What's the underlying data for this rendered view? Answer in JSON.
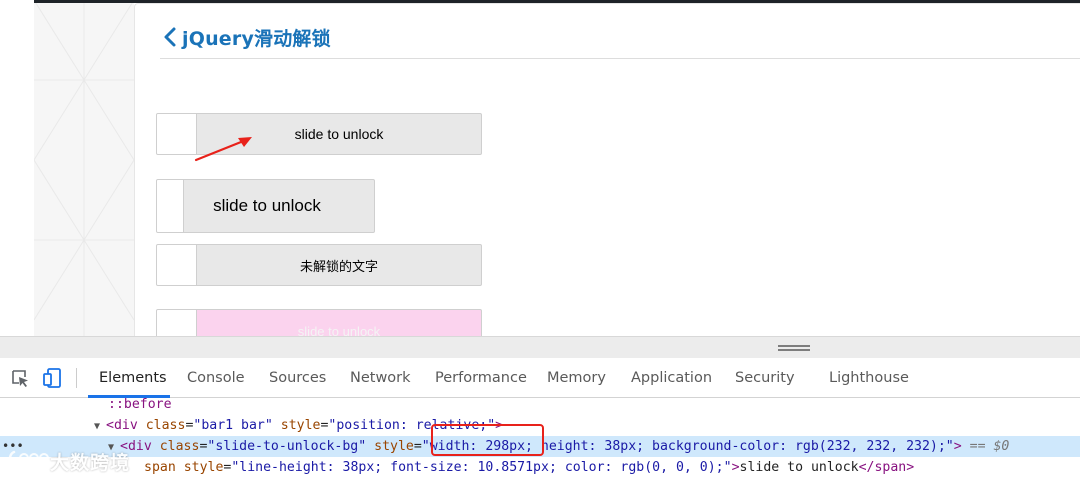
{
  "page": {
    "title": "jQuery滑动解锁",
    "back_icon": "chevron-left-icon",
    "sliders": [
      {
        "label": "slide to unlock"
      },
      {
        "label": "slide to unlock"
      },
      {
        "label": "未解锁的文字"
      },
      {
        "label": "slide to unlock"
      }
    ],
    "accent_color": "#1a73b8",
    "pink_color": "#fbd3ee",
    "annotation_color": "#e8221b"
  },
  "devtools": {
    "tabs": [
      "Elements",
      "Console",
      "Sources",
      "Network",
      "Performance",
      "Memory",
      "Application",
      "Security",
      "Lighthouse"
    ],
    "active_tab": "Elements",
    "tree": {
      "line1": "::before",
      "line2_tag": "div",
      "line2_attr1": "class",
      "line2_val1": "\"bar1 bar\"",
      "line2_attr2": "style",
      "line2_val2": "\"position: relative;\"",
      "line3_tag": "div",
      "line3_attr1": "class",
      "line3_val1": "\"slide-to-unlock-bg\"",
      "line3_attr2": "style",
      "line3_val2a": "\"width: 298px",
      "line3_val2b": "; height: 38px; background-color: rgb(232, 232, 232);\"",
      "line3_suffix": "== $0",
      "line4_attr": "span style",
      "line4_val": "\"line-height: 38px; font-size: 10.8571px; color: rgb(0, 0, 0);\"",
      "line4_text": "slide to unlock",
      "line4_close": "</span>"
    }
  },
  "watermark": {
    "text": "大数跨境"
  }
}
